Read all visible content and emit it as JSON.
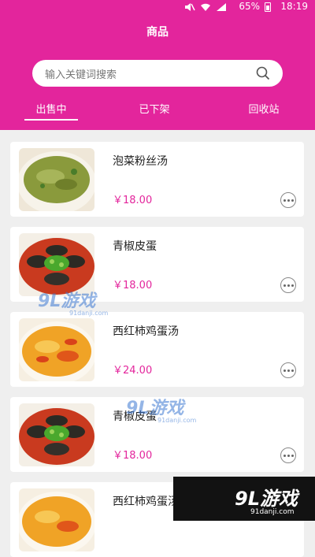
{
  "status_bar": {
    "battery": "65%",
    "time": "18:19"
  },
  "header": {
    "title": "商品"
  },
  "search": {
    "placeholder": "输入关键词搜索"
  },
  "tabs": [
    {
      "label": "出售中",
      "active": true
    },
    {
      "label": "已下架",
      "active": false
    },
    {
      "label": "回收站",
      "active": false
    }
  ],
  "products": [
    {
      "name": "泡菜粉丝汤",
      "price": "￥18.00"
    },
    {
      "name": "青椒皮蛋",
      "price": "￥18.00"
    },
    {
      "name": "西红柿鸡蛋汤",
      "price": "￥24.00"
    },
    {
      "name": "青椒皮蛋",
      "price": "￥18.00"
    },
    {
      "name": "西红柿鸡蛋汤",
      "price": ""
    }
  ],
  "watermark": {
    "logo_text": "9L游戏",
    "site": "91danji.com"
  },
  "colors": {
    "brand": "#e3259c",
    "price": "#e3259c",
    "background": "#efefef"
  }
}
